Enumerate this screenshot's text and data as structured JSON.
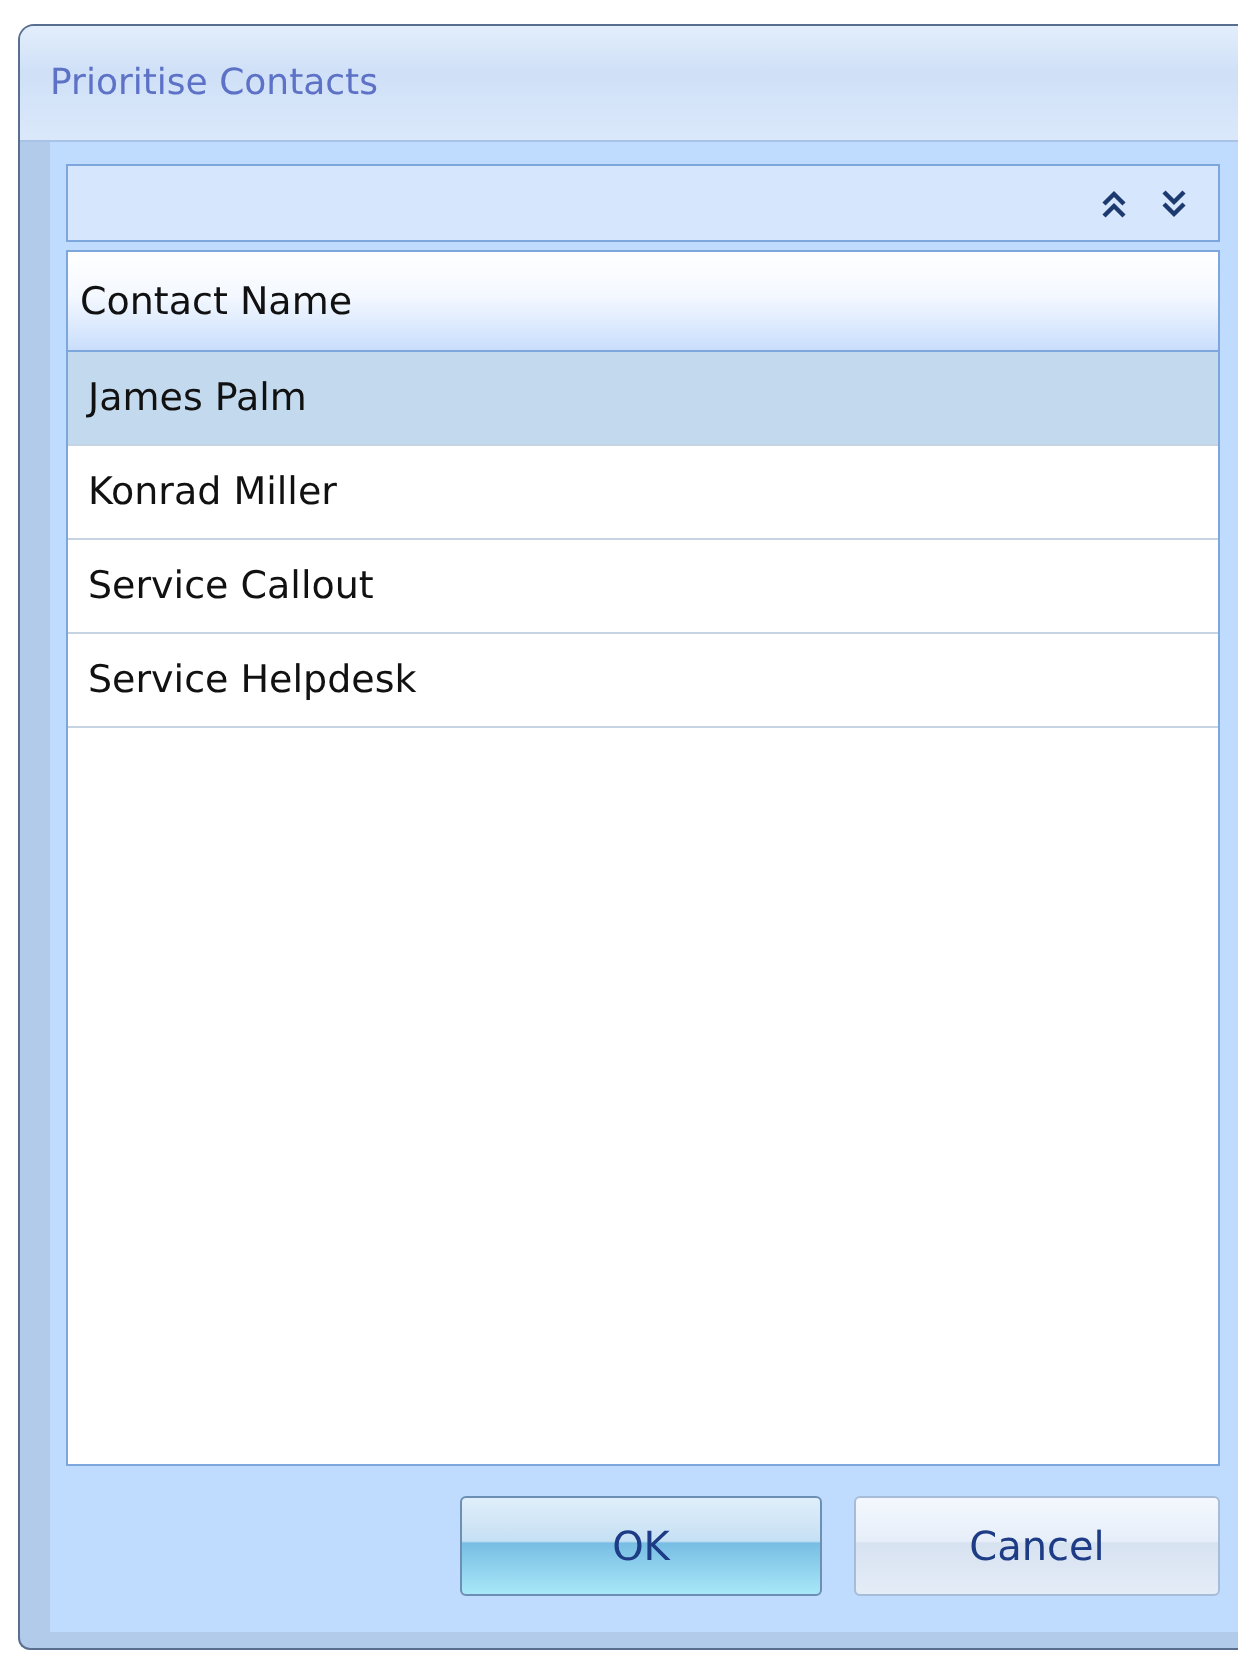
{
  "window": {
    "title": "Prioritise Contacts"
  },
  "toolbar": {
    "buttons": [
      {
        "kind": "up"
      },
      {
        "kind": "down"
      }
    ]
  },
  "table": {
    "columns": [
      "Contact Name"
    ],
    "rows": [
      {
        "name": "James Palm",
        "selected": true
      },
      {
        "name": "Konrad Miller",
        "selected": false
      },
      {
        "name": "Service Callout",
        "selected": false
      },
      {
        "name": "Service Helpdesk",
        "selected": false
      }
    ]
  },
  "buttons": [
    {
      "label": "OK",
      "default": true
    },
    {
      "label": "Cancel",
      "default": false
    }
  ]
}
